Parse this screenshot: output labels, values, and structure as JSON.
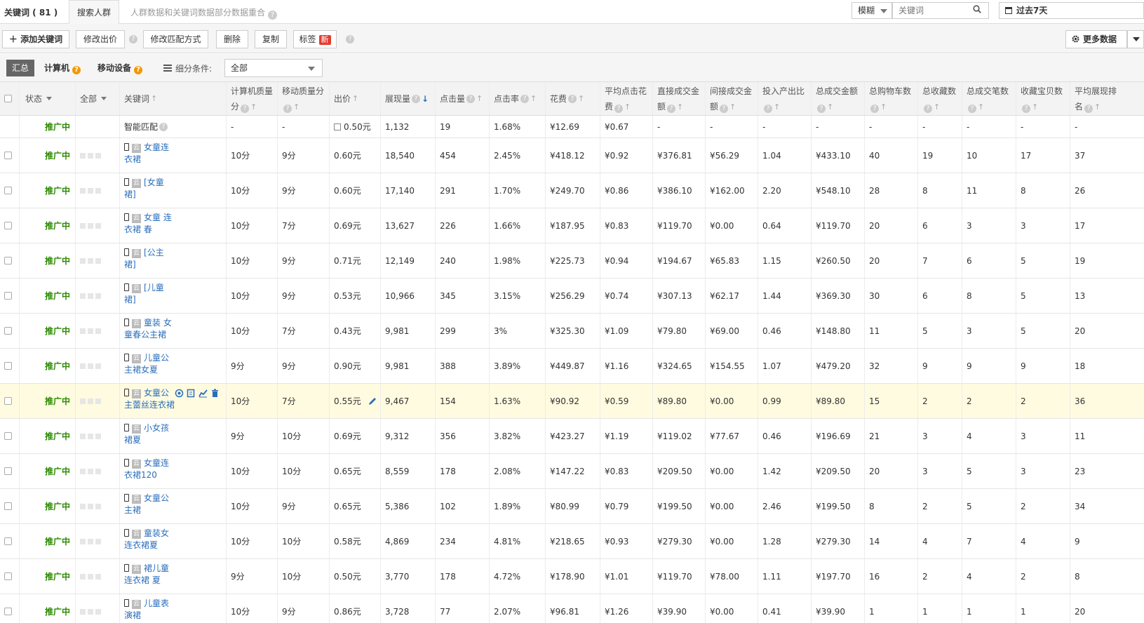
{
  "topbar": {
    "tab_keywords": "关键词 ( 81 )",
    "tab_crowd": "搜索人群",
    "note": "人群数据和关键词数据部分数据重合",
    "match_mode": "模糊",
    "search_placeholder": "关键词",
    "period": "过去7天"
  },
  "toolbar": {
    "add": "添加关键词",
    "edit_price": "修改出价",
    "edit_match": "修改匹配方式",
    "delete": "删除",
    "copy": "复制",
    "tag": "标签",
    "new_badge": "新",
    "more_data": "更多数据"
  },
  "filter": {
    "summary": "汇总",
    "computer": "计算机",
    "mobile": "移动设备",
    "detail_label": "细分条件:",
    "detail_value": "全部"
  },
  "columns": {
    "status": "状态",
    "all": "全部",
    "keyword": "关键词",
    "pc_quality": "计算机质量分",
    "mobile_quality": "移动质量分",
    "bid": "出价",
    "impressions": "展现量",
    "clicks": "点击量",
    "ctr": "点击率",
    "cost": "花费",
    "cpc": "平均点击花费",
    "direct_gmv": "直接成交金额",
    "indirect_gmv": "间接成交金额",
    "roi": "投入产出比",
    "total_gmv": "总成交金额",
    "cart": "总购物车数",
    "fav": "总收藏数",
    "orders": "总成交笔数",
    "fav_items": "收藏宝贝数",
    "avg_rank": "平均展现排名"
  },
  "smart_row": {
    "status": "推广中",
    "keyword": "智能匹配",
    "pc": "-",
    "mobile": "-",
    "bid": "0.50元",
    "impressions": "1,132",
    "clicks": "19",
    "ctr": "1.68%",
    "cost": "¥12.69",
    "cpc": "¥0.67",
    "direct": "-",
    "indirect": "-",
    "roi": "-",
    "total": "-",
    "cart": "-",
    "fav": "-",
    "orders": "-",
    "fav_items": "-",
    "rank": "-"
  },
  "rows": [
    {
      "status": "推广中",
      "kw1": "女童连",
      "kw2": "衣裙",
      "pc": "10分",
      "mobile": "9分",
      "bid": "0.60元",
      "impressions": "18,540",
      "clicks": "454",
      "ctr": "2.45%",
      "cost": "¥418.12",
      "cpc": "¥0.92",
      "direct": "¥376.81",
      "indirect": "¥56.29",
      "roi": "1.04",
      "total": "¥433.10",
      "cart": "40",
      "fav": "19",
      "orders": "10",
      "fav_items": "17",
      "rank": "37"
    },
    {
      "status": "推广中",
      "kw1": "[女童",
      "kw2": "裙]",
      "pc": "10分",
      "mobile": "9分",
      "bid": "0.60元",
      "impressions": "17,140",
      "clicks": "291",
      "ctr": "1.70%",
      "cost": "¥249.70",
      "cpc": "¥0.86",
      "direct": "¥386.10",
      "indirect": "¥162.00",
      "roi": "2.20",
      "total": "¥548.10",
      "cart": "28",
      "fav": "8",
      "orders": "11",
      "fav_items": "8",
      "rank": "26"
    },
    {
      "status": "推广中",
      "kw1": "女童 连",
      "kw2": "衣裙 春",
      "pc": "10分",
      "mobile": "7分",
      "bid": "0.69元",
      "impressions": "13,627",
      "clicks": "226",
      "ctr": "1.66%",
      "cost": "¥187.95",
      "cpc": "¥0.83",
      "direct": "¥119.70",
      "indirect": "¥0.00",
      "roi": "0.64",
      "total": "¥119.70",
      "cart": "20",
      "fav": "6",
      "orders": "3",
      "fav_items": "3",
      "rank": "17"
    },
    {
      "status": "推广中",
      "kw1": "[公主",
      "kw2": "裙]",
      "pc": "10分",
      "mobile": "9分",
      "bid": "0.71元",
      "impressions": "12,149",
      "clicks": "240",
      "ctr": "1.98%",
      "cost": "¥225.73",
      "cpc": "¥0.94",
      "direct": "¥194.67",
      "indirect": "¥65.83",
      "roi": "1.15",
      "total": "¥260.50",
      "cart": "20",
      "fav": "7",
      "orders": "6",
      "fav_items": "5",
      "rank": "19"
    },
    {
      "status": "推广中",
      "kw1": "[儿童",
      "kw2": "裙]",
      "pc": "10分",
      "mobile": "9分",
      "bid": "0.53元",
      "impressions": "10,966",
      "clicks": "345",
      "ctr": "3.15%",
      "cost": "¥256.29",
      "cpc": "¥0.74",
      "direct": "¥307.13",
      "indirect": "¥62.17",
      "roi": "1.44",
      "total": "¥369.30",
      "cart": "30",
      "fav": "6",
      "orders": "8",
      "fav_items": "5",
      "rank": "13"
    },
    {
      "status": "推广中",
      "kw1": "童装 女",
      "kw2": "童春公主裙",
      "pc": "10分",
      "mobile": "7分",
      "bid": "0.43元",
      "impressions": "9,981",
      "clicks": "299",
      "ctr": "3%",
      "cost": "¥325.30",
      "cpc": "¥1.09",
      "direct": "¥79.80",
      "indirect": "¥69.00",
      "roi": "0.46",
      "total": "¥148.80",
      "cart": "11",
      "fav": "5",
      "orders": "3",
      "fav_items": "5",
      "rank": "20"
    },
    {
      "status": "推广中",
      "kw1": "儿童公",
      "kw2": "主裙女夏",
      "pc": "9分",
      "mobile": "9分",
      "bid": "0.90元",
      "impressions": "9,981",
      "clicks": "388",
      "ctr": "3.89%",
      "cost": "¥449.87",
      "cpc": "¥1.16",
      "direct": "¥324.65",
      "indirect": "¥154.55",
      "roi": "1.07",
      "total": "¥479.20",
      "cart": "32",
      "fav": "9",
      "orders": "9",
      "fav_items": "9",
      "rank": "18"
    },
    {
      "status": "推广中",
      "kw1": "女童公",
      "kw2": "主蕾丝连衣裙",
      "pc": "10分",
      "mobile": "7分",
      "bid": "0.55元",
      "impressions": "9,467",
      "clicks": "154",
      "ctr": "1.63%",
      "cost": "¥90.92",
      "cpc": "¥0.59",
      "direct": "¥89.80",
      "indirect": "¥0.00",
      "roi": "0.99",
      "total": "¥89.80",
      "cart": "15",
      "fav": "2",
      "orders": "2",
      "fav_items": "2",
      "rank": "36",
      "highlight": true
    },
    {
      "status": "推广中",
      "kw1": "小女孩",
      "kw2": "裙夏",
      "pc": "9分",
      "mobile": "10分",
      "bid": "0.69元",
      "impressions": "9,312",
      "clicks": "356",
      "ctr": "3.82%",
      "cost": "¥423.27",
      "cpc": "¥1.19",
      "direct": "¥119.02",
      "indirect": "¥77.67",
      "roi": "0.46",
      "total": "¥196.69",
      "cart": "21",
      "fav": "3",
      "orders": "4",
      "fav_items": "3",
      "rank": "11"
    },
    {
      "status": "推广中",
      "kw1": "女童连",
      "kw2": "衣裙120",
      "pc": "10分",
      "mobile": "10分",
      "bid": "0.65元",
      "impressions": "8,559",
      "clicks": "178",
      "ctr": "2.08%",
      "cost": "¥147.22",
      "cpc": "¥0.83",
      "direct": "¥209.50",
      "indirect": "¥0.00",
      "roi": "1.42",
      "total": "¥209.50",
      "cart": "20",
      "fav": "3",
      "orders": "5",
      "fav_items": "3",
      "rank": "23"
    },
    {
      "status": "推广中",
      "kw1": "女童公",
      "kw2": "主裙",
      "pc": "10分",
      "mobile": "9分",
      "bid": "0.65元",
      "impressions": "5,386",
      "clicks": "102",
      "ctr": "1.89%",
      "cost": "¥80.99",
      "cpc": "¥0.79",
      "direct": "¥199.50",
      "indirect": "¥0.00",
      "roi": "2.46",
      "total": "¥199.50",
      "cart": "8",
      "fav": "2",
      "orders": "5",
      "fav_items": "2",
      "rank": "34"
    },
    {
      "status": "推广中",
      "kw1": "童装女",
      "kw2": "连衣裙夏",
      "pc": "10分",
      "mobile": "10分",
      "bid": "0.58元",
      "impressions": "4,869",
      "clicks": "234",
      "ctr": "4.81%",
      "cost": "¥218.65",
      "cpc": "¥0.93",
      "direct": "¥279.30",
      "indirect": "¥0.00",
      "roi": "1.28",
      "total": "¥279.30",
      "cart": "14",
      "fav": "4",
      "orders": "7",
      "fav_items": "4",
      "rank": "9"
    },
    {
      "status": "推广中",
      "kw1": "裙儿童",
      "kw2": "连衣裙 夏",
      "pc": "9分",
      "mobile": "10分",
      "bid": "0.50元",
      "impressions": "3,770",
      "clicks": "178",
      "ctr": "4.72%",
      "cost": "¥178.90",
      "cpc": "¥1.01",
      "direct": "¥119.70",
      "indirect": "¥78.00",
      "roi": "1.11",
      "total": "¥197.70",
      "cart": "16",
      "fav": "2",
      "orders": "4",
      "fav_items": "2",
      "rank": "8"
    },
    {
      "status": "推广中",
      "kw1": "儿童表",
      "kw2": "演裙",
      "pc": "10分",
      "mobile": "9分",
      "bid": "0.86元",
      "impressions": "3,728",
      "clicks": "77",
      "ctr": "2.07%",
      "cost": "¥96.81",
      "cpc": "¥1.26",
      "direct": "¥39.90",
      "indirect": "¥0.00",
      "roi": "0.41",
      "total": "¥39.90",
      "cart": "1",
      "fav": "1",
      "orders": "1",
      "fav_items": "1",
      "rank": "20"
    }
  ],
  "badges": {
    "cloud": "云"
  },
  "colors": {
    "status_green": "#2b8a00",
    "link_blue": "#2a6ebb",
    "highlight_row": "#fffbe0",
    "new_badge": "#e43d2f"
  }
}
